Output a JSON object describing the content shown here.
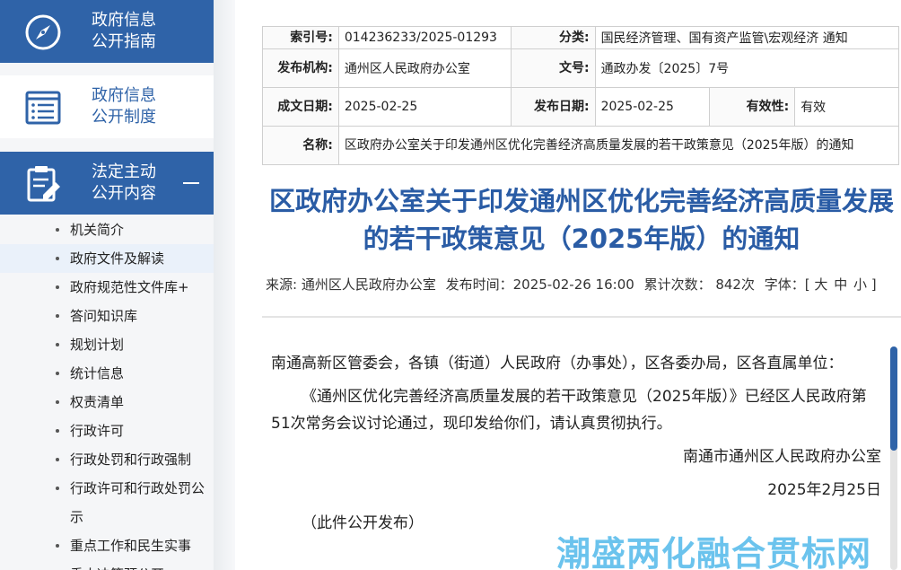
{
  "sidebar": {
    "sections": [
      {
        "line1": "政府信息",
        "line2": "公开指南"
      },
      {
        "line1": "政府信息",
        "line2": "公开制度"
      },
      {
        "line1": "法定主动",
        "line2": "公开内容"
      }
    ],
    "items": [
      "机关简介",
      "政府文件及解读",
      "政府规范性文件库+",
      "答问知识库",
      "规划计划",
      "统计信息",
      "权责清单",
      "行政许可",
      "行政处罚和行政强制",
      "行政许可和行政处罚公示",
      "重点工作和民生实事",
      "重大决策预公开"
    ]
  },
  "meta": {
    "index_label": "索引号:",
    "index_value": "014236233/2025-01293",
    "category_label": "分类:",
    "category_value": "国民经济管理、国有资产监管\\宏观经济    通知",
    "issuer_label": "发布机构:",
    "issuer_value": "通州区人民政府办公室",
    "docno_label": "文号:",
    "docno_value": "通政办发〔2025〕7号",
    "written_label": "成文日期:",
    "written_value": "2025-02-25",
    "publish_label": "发布日期:",
    "publish_value": "2025-02-25",
    "validity_label": "有效性:",
    "validity_value": "有效",
    "name_label": "名称:",
    "name_value": "区政府办公室关于印发通州区优化完善经济高质量发展的若干政策意见（2025年版）的通知"
  },
  "article": {
    "title": "区政府办公室关于印发通州区优化完善经济高质量发展的若干政策意见（2025年版）的通知",
    "source": "来源: 通州区人民政府办公室",
    "time": "发布时间：2025-02-26 16:00",
    "views": "累计次数： 842次",
    "font_label": "字体：",
    "font_large": "大",
    "font_medium": "中",
    "font_small": "小",
    "salutation": "南通高新区管委会，各镇（街道）人民政府（办事处），区各委办局，区各直属单位：",
    "paragraph1": "《通州区优化完善经济高质量发展的若干政策意见（2025年版）》已经区人民政府第51次常务会议讨论通过，现印发给你们，请认真贯彻执行。",
    "signature": "南通市通州区人民政府办公室",
    "date": "2025年2月25日",
    "note": "（此件公开发布）"
  },
  "watermark": "潮盛两化融合贯标网",
  "colors": {
    "accent": "#2f63a8",
    "title": "#2a5ca5",
    "watermark": "#3ab0e8"
  }
}
